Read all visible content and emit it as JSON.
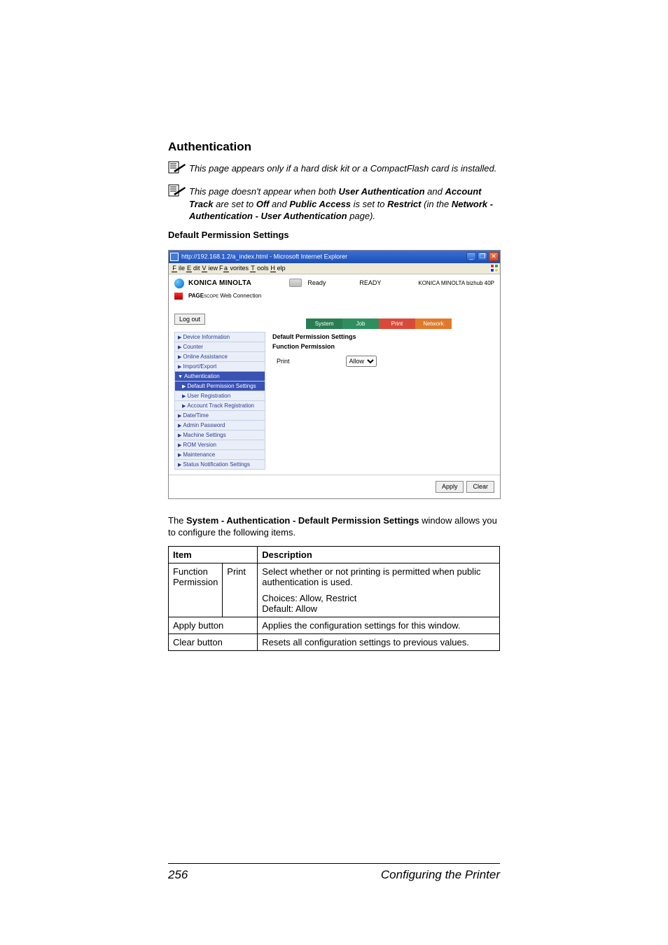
{
  "heading": "Authentication",
  "note1": {
    "pre": "This page appears only if a hard disk kit or a CompactFlash card is installed."
  },
  "note2": {
    "p1": "This page doesn't appear when both ",
    "b1": "User Authentication",
    "p2": " and ",
    "b2": "Account Track",
    "p3": " are set to ",
    "b3": "Off",
    "p4": " and ",
    "b4": "Public Access",
    "p5": " is set to ",
    "b5": "Restrict",
    "p6": " (in the ",
    "b6": "Network - Authentication - User Authentication",
    "p7": " page)."
  },
  "subheading": "Default Permission Settings",
  "screenshot": {
    "titlebar": "http://192.168.1.2/a_index.html - Microsoft Internet Explorer",
    "menus": {
      "file": "File",
      "edit": "Edit",
      "view": "View",
      "fav": "Favorites",
      "tools": "Tools",
      "help": "Help"
    },
    "brand": "KONICA MINOLTA",
    "brand2_a": "PAGE",
    "brand2_b": "SCOPE",
    "brand2_c": " Web Connection",
    "status_label": "Ready",
    "status_big": "READY",
    "device": "KONICA MINOLTA bizhub 40P",
    "logout": "Log out",
    "tabs": {
      "system": "System",
      "job": "Job",
      "print": "Print",
      "network": "Network"
    },
    "nav": {
      "device": "Device Information",
      "counter": "Counter",
      "online": "Online Assistance",
      "import": "Import/Export",
      "auth": "Authentication",
      "defperm": "Default Permission Settings",
      "userreg": "User Registration",
      "acct": "Account Track Registration",
      "datetime": "Date/Time",
      "admin": "Admin Password",
      "machine": "Machine Settings",
      "rom": "ROM Version",
      "maint": "Maintenance",
      "status": "Status Notification Settings"
    },
    "content": {
      "title": "Default Permission Settings",
      "section": "Function Permission",
      "row_label": "Print",
      "row_value": "Allow"
    },
    "buttons": {
      "apply": "Apply",
      "clear": "Clear"
    }
  },
  "body_para": {
    "p1": "The ",
    "b1": "System - Authentication - Default Permission Settings",
    "p2": " window allows you to configure the following items."
  },
  "table": {
    "h_item": "Item",
    "h_desc": "Description",
    "r1c1": "Function Permission",
    "r1c2": "Print",
    "r1c3a": "Select whether or not printing is permitted when public authentication is used.",
    "r1c3b": "Choices: Allow, Restrict",
    "r1c3c": "Default:  Allow",
    "r2c1": "Apply button",
    "r2c2": "Applies the configuration settings for this window.",
    "r3c1": "Clear button",
    "r3c2": "Resets all configuration settings to previous values."
  },
  "footer": {
    "pageno": "256",
    "title": "Configuring the Printer"
  }
}
